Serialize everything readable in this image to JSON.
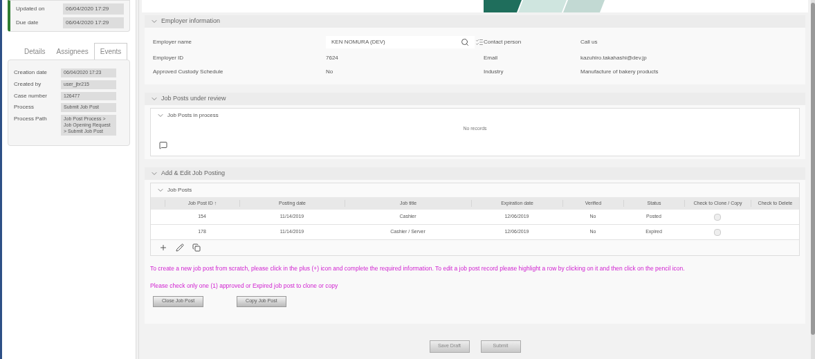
{
  "sidebar": {
    "summary": [
      {
        "label": "Updated on",
        "value": "06/04/2020 17:29"
      },
      {
        "label": "Due date",
        "value": "06/04/2020 17:29"
      }
    ],
    "tabs": [
      {
        "label": "Details",
        "selected": false
      },
      {
        "label": "Assignees",
        "selected": false
      },
      {
        "label": "Events",
        "selected": true
      }
    ],
    "details": [
      {
        "label": "Creation date",
        "value": "06/04/2020 17:23"
      },
      {
        "label": "Created by",
        "value": "user_jbr215"
      },
      {
        "label": "Case number",
        "value": "126477"
      },
      {
        "label": "Process",
        "value": "Submit Job Post"
      },
      {
        "label": "Process Path",
        "value": "Job Post Process > Job Opening Request > Submit Job Post"
      }
    ]
  },
  "employer_information": {
    "title": "Employer information",
    "expanded": true,
    "employer_name": {
      "label": "Employer name",
      "value": "KEN NOMURA (DEV)"
    },
    "fields_left": [
      {
        "label": "Employer ID",
        "value": "7624"
      },
      {
        "label": "Approved Custody Schedule",
        "value": "No"
      }
    ],
    "contact_person": {
      "label": "Contact person",
      "value": "Call us"
    },
    "fields_right": [
      {
        "label": "Email",
        "value": "kazuhiro.takahashi@dev.jp"
      },
      {
        "label": "Industry",
        "value": "Manufacture of bakery products"
      }
    ]
  },
  "job_posts_under_review": {
    "title": "Job Posts under review",
    "expanded": true,
    "in_process": {
      "title": "Job Posts in process",
      "expanded": true,
      "empty_text": "No records"
    }
  },
  "add_edit": {
    "title": "Add & Edit Job Posting",
    "expanded": true,
    "table": {
      "title": "Job Posts",
      "expanded": true,
      "columns": [
        "Job Post ID ↑",
        "Posting date",
        "Job title",
        "Expiration date",
        "Verified",
        "Status",
        "Check to Clone / Copy",
        "Check to Delete"
      ],
      "rows": [
        {
          "cells": [
            "154",
            "11/14/2019",
            "Cashier",
            "12/06/2019",
            "No",
            "Posted"
          ],
          "checked": false
        },
        {
          "cells": [
            "178",
            "11/14/2019",
            "Cashier / Server",
            "12/06/2019",
            "No",
            "Expired"
          ],
          "checked": false
        }
      ]
    },
    "instructions": [
      "To create a new job post from scratch, please click in the plus (+) icon and complete the required information. To edit a job post record please highlight a row by clicking on it and then click on the pencil icon.",
      "Please check only one (1) approved or Expired job post to clone or copy"
    ],
    "buttons": [
      "Close Job Post",
      "Copy Job Post"
    ]
  },
  "footer_buttons": [
    "Save Draft",
    "Submit"
  ]
}
